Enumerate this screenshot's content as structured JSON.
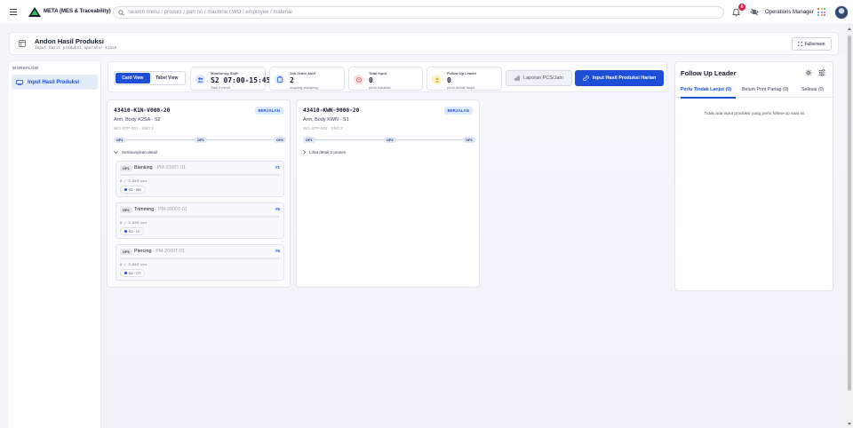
{
  "app": {
    "brand": "META (MES & Traceability)",
    "role": "Operations Manager",
    "notification_count": "6"
  },
  "search": {
    "placeholder": "Search menu / product / part no / machine / WO / employee / material"
  },
  "page": {
    "title": "Andon Hasil Produksi",
    "subtitle": "Input hasil produksi operator kiosk",
    "fullscreen_label": "Fullscreen"
  },
  "sidebar": {
    "section_label": "WORKFLOW",
    "items": [
      {
        "label": "Input Hasil Produksi"
      }
    ]
  },
  "toolbar": {
    "views": [
      {
        "label": "Card View"
      },
      {
        "label": "Tabel View"
      }
    ],
    "stats": [
      {
        "label": "Monitoring Shift",
        "value": "S2 07:00-15:45",
        "note": "Sisa 0 menit"
      },
      {
        "label": "Job Order Aktif",
        "value": "2",
        "note": "ongoing stamping"
      },
      {
        "label": "Total Input",
        "value": "0",
        "note": "perlu eskalasi"
      },
      {
        "label": "Follow Up Leader",
        "value": "0",
        "note": "perlu tindak lanjut"
      }
    ],
    "report_label": "Laporan PCS/Jam",
    "input_label": "Input Hasil Produksi Harian"
  },
  "jobs": [
    {
      "code": "43410-K1N-V000-20",
      "status": "BERJALAN",
      "part": "Arm, Body K2SA - S2",
      "wo": "WO-STP-001 · Shift 2",
      "ops": [
        "OP1",
        "OP2",
        "OP3"
      ],
      "toggle_label": "Sembunyikan detail",
      "processes": [
        {
          "op": "OP1",
          "name": "Blanking",
          "machine": " · PM-2000T-01",
          "num": "#1",
          "qty": "0 / 3.049 pcs",
          "progress": 0,
          "tag": "S2 · BO"
        },
        {
          "op": "OP2",
          "name": "Trimming",
          "machine": " · PM-2000T-01",
          "num": "#5",
          "qty": "0 / 3.049 pcs",
          "progress": 0,
          "tag": "S2 · IS"
        },
        {
          "op": "OP3",
          "name": "Piercing",
          "machine": " · PM-2000T-01",
          "num": "#5",
          "qty": "0 / 3.049 pcs",
          "progress": 0,
          "tag": "S2 · CT"
        }
      ]
    },
    {
      "code": "43410-KWN-9000-20",
      "status": "BERJALAN",
      "part": "Arm, Body KWN - S1",
      "wo": "WO-STP-002 · Shift 2",
      "ops": [
        "OP1",
        "OP2",
        "OP3"
      ],
      "toggle_label": "Lihat detail 3 proses",
      "processes": []
    }
  ],
  "followup": {
    "title": "Follow Up Leader",
    "tabs": [
      {
        "label": "Perlu Tindak Lanjut (0)"
      },
      {
        "label": "Belum Print Partag (0)"
      },
      {
        "label": "Selesai (0)"
      }
    ],
    "empty_text": "Tidak ada input produksi yang perlu follow-up saat ini."
  },
  "colors": {
    "primary": "#1d4ed8",
    "badge": "#e11d48",
    "status_bg": "#dbeafe"
  }
}
